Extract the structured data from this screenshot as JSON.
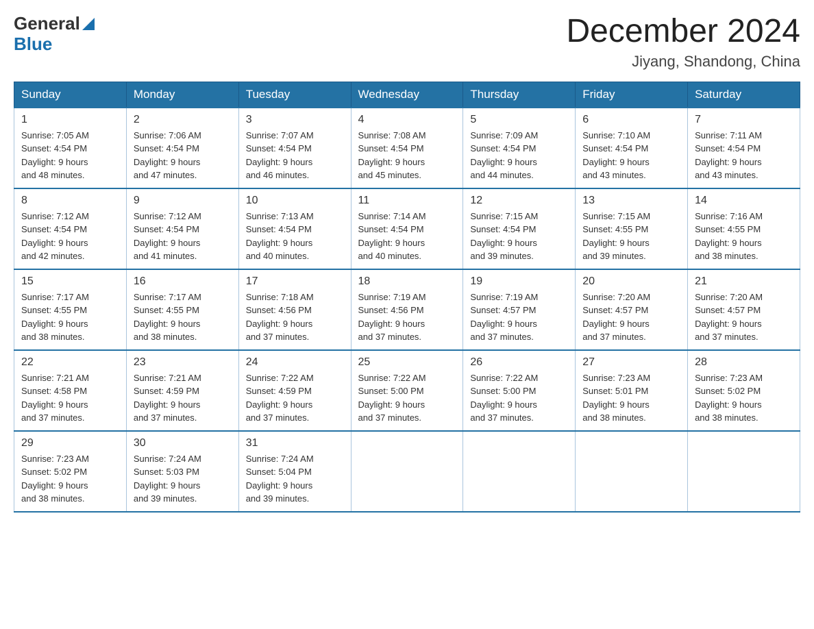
{
  "header": {
    "logo": {
      "general": "General",
      "blue": "Blue",
      "triangle_label": "logo-triangle"
    },
    "title": "December 2024",
    "location": "Jiyang, Shandong, China"
  },
  "calendar": {
    "days_of_week": [
      "Sunday",
      "Monday",
      "Tuesday",
      "Wednesday",
      "Thursday",
      "Friday",
      "Saturday"
    ],
    "weeks": [
      [
        {
          "day": "1",
          "sunrise": "7:05 AM",
          "sunset": "4:54 PM",
          "daylight": "9 hours and 48 minutes."
        },
        {
          "day": "2",
          "sunrise": "7:06 AM",
          "sunset": "4:54 PM",
          "daylight": "9 hours and 47 minutes."
        },
        {
          "day": "3",
          "sunrise": "7:07 AM",
          "sunset": "4:54 PM",
          "daylight": "9 hours and 46 minutes."
        },
        {
          "day": "4",
          "sunrise": "7:08 AM",
          "sunset": "4:54 PM",
          "daylight": "9 hours and 45 minutes."
        },
        {
          "day": "5",
          "sunrise": "7:09 AM",
          "sunset": "4:54 PM",
          "daylight": "9 hours and 44 minutes."
        },
        {
          "day": "6",
          "sunrise": "7:10 AM",
          "sunset": "4:54 PM",
          "daylight": "9 hours and 43 minutes."
        },
        {
          "day": "7",
          "sunrise": "7:11 AM",
          "sunset": "4:54 PM",
          "daylight": "9 hours and 43 minutes."
        }
      ],
      [
        {
          "day": "8",
          "sunrise": "7:12 AM",
          "sunset": "4:54 PM",
          "daylight": "9 hours and 42 minutes."
        },
        {
          "day": "9",
          "sunrise": "7:12 AM",
          "sunset": "4:54 PM",
          "daylight": "9 hours and 41 minutes."
        },
        {
          "day": "10",
          "sunrise": "7:13 AM",
          "sunset": "4:54 PM",
          "daylight": "9 hours and 40 minutes."
        },
        {
          "day": "11",
          "sunrise": "7:14 AM",
          "sunset": "4:54 PM",
          "daylight": "9 hours and 40 minutes."
        },
        {
          "day": "12",
          "sunrise": "7:15 AM",
          "sunset": "4:54 PM",
          "daylight": "9 hours and 39 minutes."
        },
        {
          "day": "13",
          "sunrise": "7:15 AM",
          "sunset": "4:55 PM",
          "daylight": "9 hours and 39 minutes."
        },
        {
          "day": "14",
          "sunrise": "7:16 AM",
          "sunset": "4:55 PM",
          "daylight": "9 hours and 38 minutes."
        }
      ],
      [
        {
          "day": "15",
          "sunrise": "7:17 AM",
          "sunset": "4:55 PM",
          "daylight": "9 hours and 38 minutes."
        },
        {
          "day": "16",
          "sunrise": "7:17 AM",
          "sunset": "4:55 PM",
          "daylight": "9 hours and 38 minutes."
        },
        {
          "day": "17",
          "sunrise": "7:18 AM",
          "sunset": "4:56 PM",
          "daylight": "9 hours and 37 minutes."
        },
        {
          "day": "18",
          "sunrise": "7:19 AM",
          "sunset": "4:56 PM",
          "daylight": "9 hours and 37 minutes."
        },
        {
          "day": "19",
          "sunrise": "7:19 AM",
          "sunset": "4:57 PM",
          "daylight": "9 hours and 37 minutes."
        },
        {
          "day": "20",
          "sunrise": "7:20 AM",
          "sunset": "4:57 PM",
          "daylight": "9 hours and 37 minutes."
        },
        {
          "day": "21",
          "sunrise": "7:20 AM",
          "sunset": "4:57 PM",
          "daylight": "9 hours and 37 minutes."
        }
      ],
      [
        {
          "day": "22",
          "sunrise": "7:21 AM",
          "sunset": "4:58 PM",
          "daylight": "9 hours and 37 minutes."
        },
        {
          "day": "23",
          "sunrise": "7:21 AM",
          "sunset": "4:59 PM",
          "daylight": "9 hours and 37 minutes."
        },
        {
          "day": "24",
          "sunrise": "7:22 AM",
          "sunset": "4:59 PM",
          "daylight": "9 hours and 37 minutes."
        },
        {
          "day": "25",
          "sunrise": "7:22 AM",
          "sunset": "5:00 PM",
          "daylight": "9 hours and 37 minutes."
        },
        {
          "day": "26",
          "sunrise": "7:22 AM",
          "sunset": "5:00 PM",
          "daylight": "9 hours and 37 minutes."
        },
        {
          "day": "27",
          "sunrise": "7:23 AM",
          "sunset": "5:01 PM",
          "daylight": "9 hours and 38 minutes."
        },
        {
          "day": "28",
          "sunrise": "7:23 AM",
          "sunset": "5:02 PM",
          "daylight": "9 hours and 38 minutes."
        }
      ],
      [
        {
          "day": "29",
          "sunrise": "7:23 AM",
          "sunset": "5:02 PM",
          "daylight": "9 hours and 38 minutes."
        },
        {
          "day": "30",
          "sunrise": "7:24 AM",
          "sunset": "5:03 PM",
          "daylight": "9 hours and 39 minutes."
        },
        {
          "day": "31",
          "sunrise": "7:24 AM",
          "sunset": "5:04 PM",
          "daylight": "9 hours and 39 minutes."
        },
        null,
        null,
        null,
        null
      ]
    ]
  }
}
